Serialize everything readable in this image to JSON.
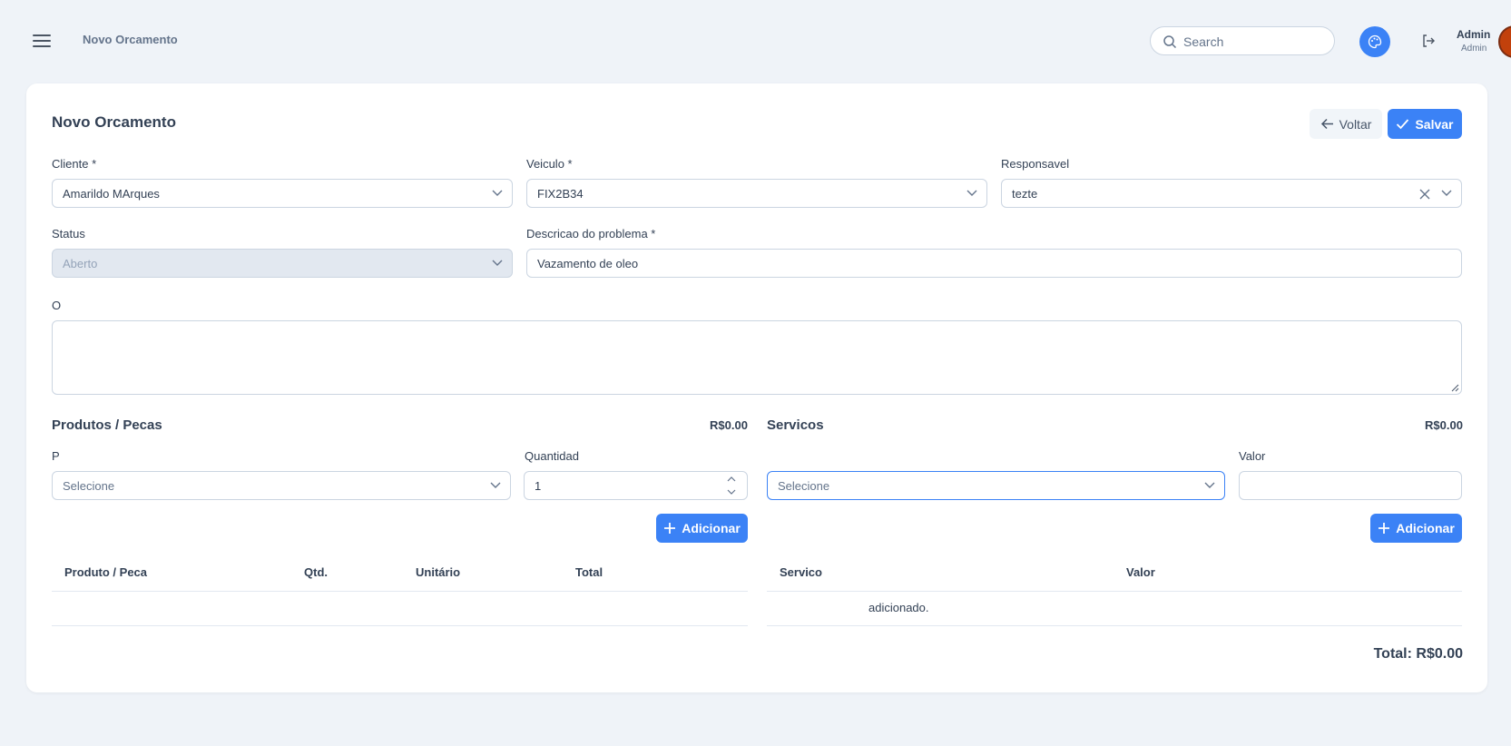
{
  "header": {
    "breadcrumb": "Novo Orcamento",
    "search_placeholder": "Search",
    "user_name": "Admin",
    "user_role": "Admin"
  },
  "page": {
    "title": "Novo Orcamento",
    "back_label": "Voltar",
    "save_label": "Salvar"
  },
  "form": {
    "cliente": {
      "label": "Cliente *",
      "value": "Amarildo MArques"
    },
    "veiculo": {
      "label": "Veiculo *",
      "value": "FIX2B34"
    },
    "responsavel": {
      "label": "Responsavel",
      "value": "tezte"
    },
    "status": {
      "label": "Status",
      "value": "Aberto"
    },
    "descricao": {
      "label": "Descricao do problema *",
      "value": "Vazamento de oleo"
    },
    "observacoes": {
      "label": "O",
      "value": ""
    }
  },
  "produtos": {
    "title": "Produtos / Pecas",
    "subtotal": "R$0.00",
    "produto_label": "P",
    "produto_placeholder": "Selecione",
    "quantidade_label": "Quantidad",
    "quantidade_value": "1",
    "add_label": "Adicionar",
    "columns": [
      "Produto / Peca",
      "Qtd.",
      "Unitário",
      "Total"
    ]
  },
  "servicos": {
    "title": "Servicos",
    "subtotal": "R$0.00",
    "servico_placeholder": "Selecione",
    "valor_label": "Valor",
    "valor_value": "",
    "add_label": "Adicionar",
    "columns": [
      "Servico",
      "Valor"
    ],
    "empty_text": "adicionado."
  },
  "footer": {
    "total": "Total: R$0.00"
  },
  "colors": {
    "primary": "#3b82f6",
    "background": "#eff3f8",
    "card": "#ffffff",
    "border": "#cbd5e1",
    "text": "#334155"
  }
}
